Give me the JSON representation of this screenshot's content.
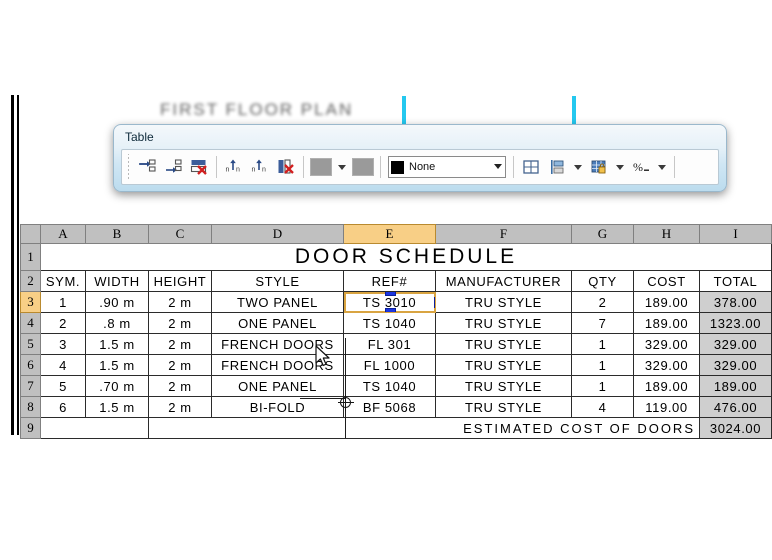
{
  "background": {
    "faded_title": "FIRST FLOOR PLAN"
  },
  "toolbar": {
    "title": "Table",
    "buttons": [
      {
        "name": "insert-row-above-button",
        "tip": "Insert Row Above"
      },
      {
        "name": "insert-row-below-button",
        "tip": "Insert Row Below"
      },
      {
        "name": "delete-row-button",
        "tip": "Delete Row"
      },
      {
        "name": "insert-column-left-button",
        "tip": "Insert Column Left"
      },
      {
        "name": "insert-column-right-button",
        "tip": "Insert Column Right"
      },
      {
        "name": "delete-column-button",
        "tip": "Delete Column"
      }
    ],
    "cell_background_color": "#9a9a9a",
    "cell_border_color": "#9a9a9a",
    "linetype": {
      "value": "None",
      "swatch_color": "#000000"
    },
    "right_buttons": [
      {
        "name": "merge-cells-button",
        "tip": "Merge Cells"
      },
      {
        "name": "cell-alignment-button",
        "tip": "Cell Alignment"
      },
      {
        "name": "cell-locking-button",
        "tip": "Cell Locking"
      },
      {
        "name": "data-format-button",
        "tip": "Data Format",
        "glyph": "%"
      }
    ]
  },
  "sheet": {
    "column_headers": [
      "A",
      "B",
      "C",
      "D",
      "E",
      "F",
      "G",
      "H",
      "I"
    ],
    "selected_column": "E",
    "row_headers": [
      "1",
      "2",
      "3",
      "4",
      "5",
      "6",
      "7",
      "8",
      "9"
    ],
    "selected_row": "3",
    "title_row": "DOOR SCHEDULE",
    "header_row": [
      "SYM.",
      "WIDTH",
      "HEIGHT",
      "STYLE",
      "REF#",
      "MANUFACTURER",
      "QTY",
      "COST",
      "TOTAL"
    ],
    "rows": [
      {
        "sym": "1",
        "width": ".90 m",
        "height": "2 m",
        "style": "TWO PANEL",
        "ref": "TS 3010",
        "manufacturer": "TRU STYLE",
        "qty": "2",
        "cost": "189.00",
        "total": "378.00"
      },
      {
        "sym": "2",
        "width": ".8 m",
        "height": "2 m",
        "style": "ONE PANEL",
        "ref": "TS 1040",
        "manufacturer": "TRU STYLE",
        "qty": "7",
        "cost": "189.00",
        "total": "1323.00"
      },
      {
        "sym": "3",
        "width": "1.5 m",
        "height": "2 m",
        "style": "FRENCH DOORS",
        "ref": "FL 301",
        "manufacturer": "TRU STYLE",
        "qty": "1",
        "cost": "329.00",
        "total": "329.00"
      },
      {
        "sym": "4",
        "width": "1.5 m",
        "height": "2 m",
        "style": "FRENCH DOORS",
        "ref": "FL 1000",
        "manufacturer": "TRU STYLE",
        "qty": "1",
        "cost": "329.00",
        "total": "329.00"
      },
      {
        "sym": "5",
        "width": ".70 m",
        "height": "2 m",
        "style": "ONE PANEL",
        "ref": "TS 1040",
        "manufacturer": "TRU STYLE",
        "qty": "1",
        "cost": "189.00",
        "total": "189.00"
      },
      {
        "sym": "6",
        "width": "1.5 m",
        "height": "2 m",
        "style": "BI-FOLD",
        "ref": "BF 5068",
        "manufacturer": "TRU STYLE",
        "qty": "4",
        "cost": "119.00",
        "total": "476.00"
      }
    ],
    "summary": {
      "label": "ESTIMATED COST OF DOORS",
      "value": "3024.00"
    },
    "selected_cell": {
      "address": "E3",
      "value": "TS 3010",
      "grip_color": "#1c36e0",
      "border_color": "#d9a441"
    }
  }
}
